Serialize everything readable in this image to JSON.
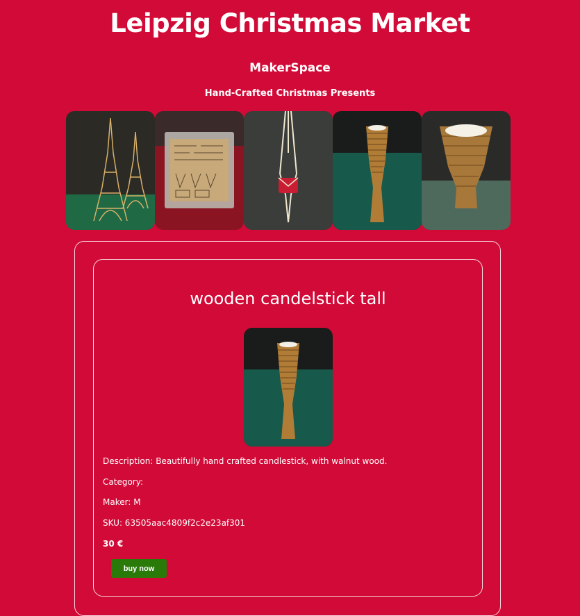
{
  "header": {
    "title": "Leipzig Christmas Market",
    "subtitle": "MakerSpace",
    "tagline": "Hand-Crafted Christmas Presents"
  },
  "gallery": {
    "items": [
      {
        "icon": "eiffel-tower-models-image"
      },
      {
        "icon": "laser-cut-sheet-image"
      },
      {
        "icon": "macrame-hanger-image"
      },
      {
        "icon": "tall-candlestick-image"
      },
      {
        "icon": "tealight-holder-image"
      }
    ]
  },
  "product": {
    "title": "wooden candelstick tall",
    "image_icon": "tall-candlestick-image",
    "description": "Description: Beautifully hand crafted candlestick, with walnut wood.",
    "category": "Category:",
    "maker": "Maker: M",
    "sku": "SKU: 63505aac4809f2c2e23af301",
    "price": "30 €",
    "buy_label": "buy now"
  },
  "colors": {
    "background": "#d20a37",
    "button": "#2a7a0a",
    "text": "#ffffff"
  }
}
